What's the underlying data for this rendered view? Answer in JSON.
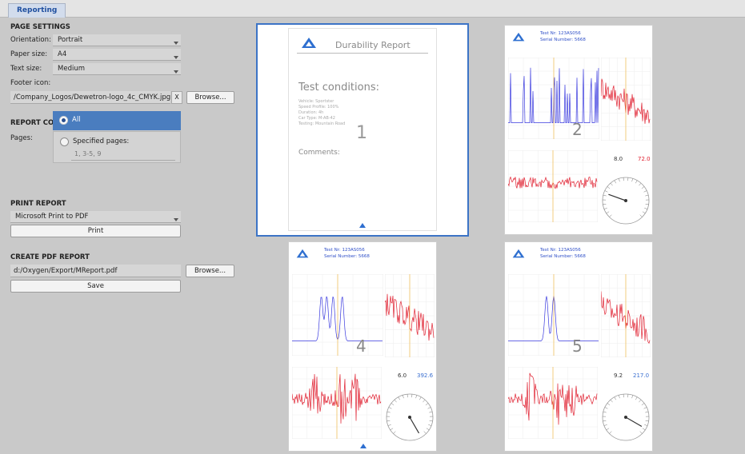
{
  "tab": {
    "label": "Reporting"
  },
  "page_settings": {
    "header": "PAGE SETTINGS",
    "orientation_label": "Orientation:",
    "orientation_value": "Portrait",
    "paper_label": "Paper size:",
    "paper_value": "A4",
    "text_label": "Text size:",
    "text_value": "Medium",
    "footer_label": "Footer icon:",
    "footer_path": "/Company_Logos/Dewetron-logo_4c_CMYK.jpg",
    "clear_label": "X",
    "browse_label": "Browse..."
  },
  "report_content": {
    "header": "REPORT CONTENT: 5 PAGES",
    "pages_label": "Pages:",
    "all_label": "All",
    "specified_label": "Specified pages:",
    "specified_placeholder": "1, 3-5, 9"
  },
  "print_report": {
    "header": "PRINT REPORT",
    "printer": "Microsoft Print to PDF",
    "print_label": "Print"
  },
  "create_pdf": {
    "header": "CREATE PDF REPORT",
    "path": "d:/Oxygen/Export/MReport.pdf",
    "browse_label": "Browse...",
    "save_label": "Save"
  },
  "previews": {
    "page1": {
      "title": "Durability Report",
      "section": "Test conditions:",
      "details": [
        "Vehicle: Sportster",
        "Speed Profile: 100%",
        "Duration: 4h",
        "Car Type: M-AB-42",
        "Testing: Mountain Road"
      ],
      "comments": "Comments:",
      "number": "1"
    },
    "page2": {
      "test_no": "Test Nr: 123AS056",
      "serial": "Serial Number: 5668",
      "number": "2",
      "val_left": "8.0",
      "val_right": "72.0"
    },
    "page4": {
      "test_no": "Test Nr: 123AS056",
      "serial": "Serial Number: 5668",
      "number": "4",
      "val_left": "6.0",
      "val_right": "392.6"
    },
    "page5": {
      "test_no": "Test Nr: 123AS056",
      "serial": "Serial Number: 5668",
      "number": "5",
      "val_left": "9.2",
      "val_right": "217.0"
    }
  },
  "colors": {
    "accent": "#4a7dbf",
    "selection": "#3c74c6",
    "signal_blue": "#3a3adf",
    "signal_red": "#e02030"
  }
}
